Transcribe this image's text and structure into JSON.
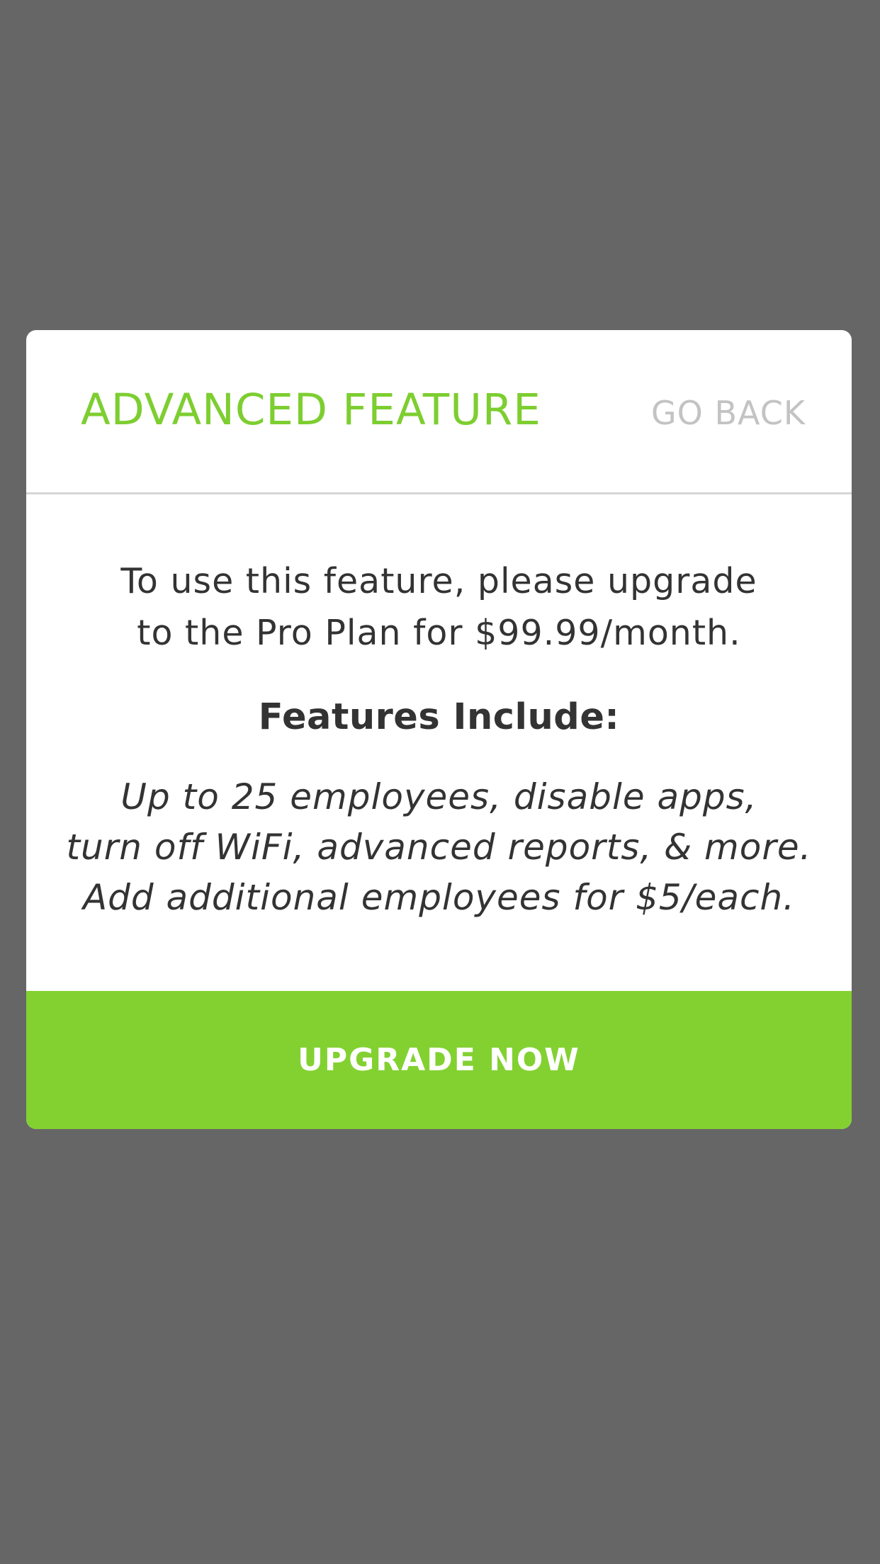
{
  "modal": {
    "title": "ADVANCED FEATURE",
    "go_back_label": "GO BACK",
    "intro_line_1": "To use this feature, please upgrade",
    "intro_line_2": "to the Pro Plan for $99.99/month.",
    "features_title": "Features Include:",
    "features_line_1": "Up to 25 employees, disable apps,",
    "features_line_2": "turn off WiFi, advanced reports, & more.",
    "features_line_3": "Add additional employees for $5/each.",
    "upgrade_label": "UPGRADE NOW"
  },
  "colors": {
    "overlay": "#666666",
    "accent_green": "#83d131",
    "title_green": "#7dce30",
    "go_back_gray": "#c3c3c3",
    "body_text": "#333333",
    "divider": "#d6d6d6"
  }
}
